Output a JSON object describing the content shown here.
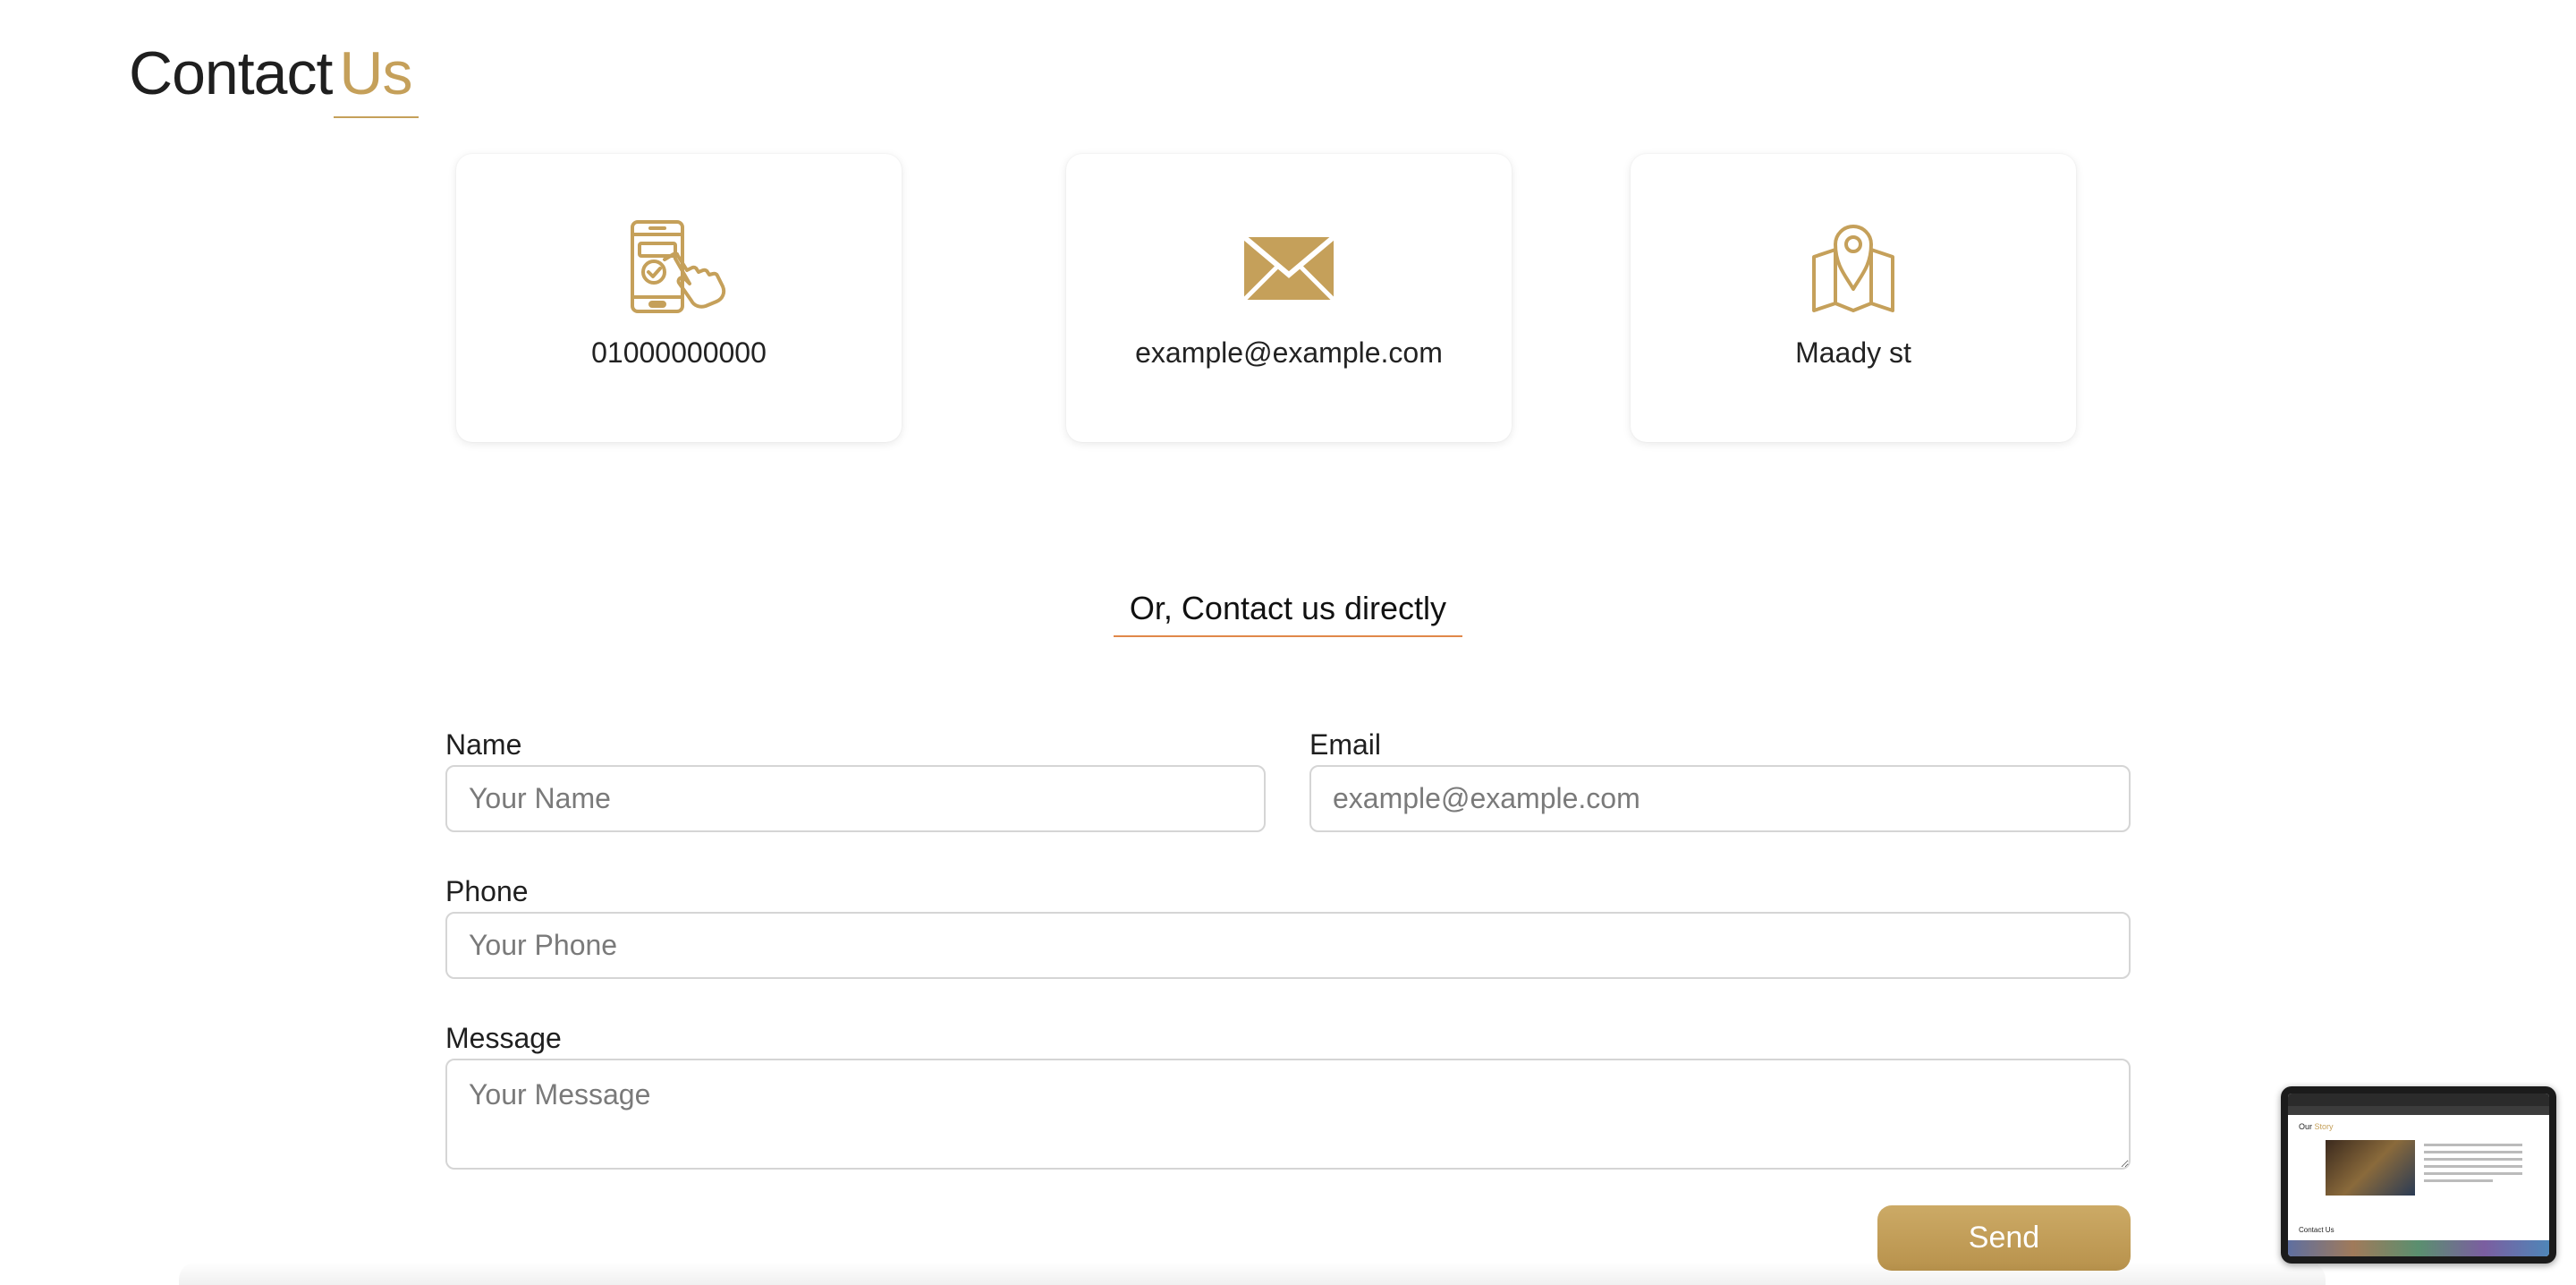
{
  "header": {
    "title_part1": "Contact",
    "title_part2": "Us"
  },
  "cards": {
    "phone": {
      "icon": "phone-touch-icon",
      "text": "01000000000"
    },
    "email": {
      "icon": "envelope-icon",
      "text": "example@example.com"
    },
    "address": {
      "icon": "map-pin-icon",
      "text": "Maady st"
    }
  },
  "form": {
    "heading": "Or, Contact us directly",
    "name": {
      "label": "Name",
      "placeholder": "Your Name",
      "value": ""
    },
    "email": {
      "label": "Email",
      "placeholder": "example@example.com",
      "value": ""
    },
    "phone": {
      "label": "Phone",
      "placeholder": "Your Phone",
      "value": ""
    },
    "message": {
      "label": "Message",
      "placeholder": "Your Message",
      "value": ""
    },
    "submit_label": "Send"
  },
  "preview": {
    "heading_part1": "Our",
    "heading_part2": "Story",
    "section_label": "Contact Us"
  },
  "colors": {
    "accent": "#c5a05a",
    "underline": "#e0884a",
    "button": "#c29d56"
  }
}
